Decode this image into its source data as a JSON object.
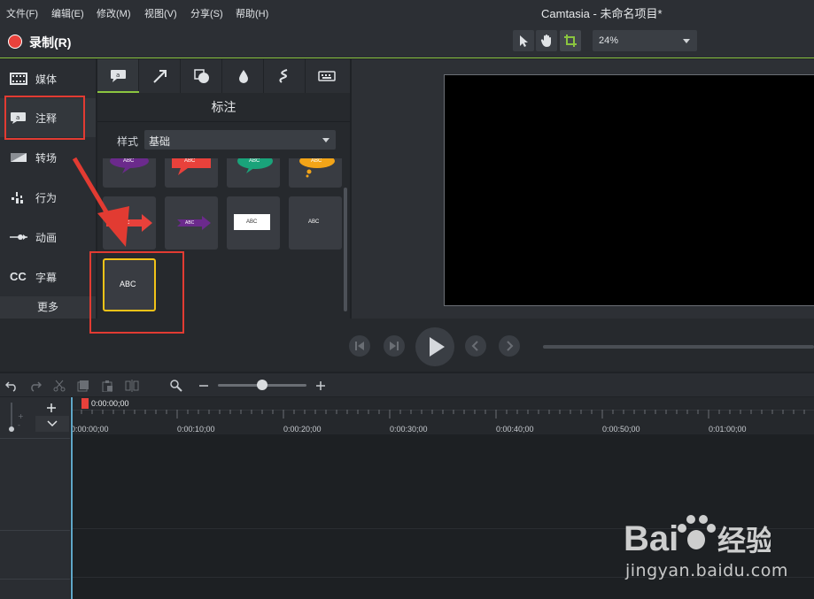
{
  "menu": [
    "文件(F)",
    "编辑(E)",
    "修改(M)",
    "视图(V)",
    "分享(S)",
    "帮助(H)"
  ],
  "window_title": "Camtasia - 未命名项目*",
  "toolbar": {
    "record_label": "录制(R)",
    "zoom": "24%"
  },
  "sidebar": {
    "items": [
      {
        "label": "媒体",
        "icon": "film-strip-icon"
      },
      {
        "label": "注释",
        "icon": "annotation-icon"
      },
      {
        "label": "转场",
        "icon": "transition-icon"
      },
      {
        "label": "行为",
        "icon": "behavior-icon"
      },
      {
        "label": "动画",
        "icon": "animation-icon"
      },
      {
        "label": "字幕",
        "icon": "cc-icon",
        "badge": "CC"
      }
    ],
    "more": "更多"
  },
  "panel": {
    "tabs": [
      "callout-tab-icon",
      "arrow-tab-icon",
      "shape-tab-icon",
      "blur-tab-icon",
      "sketch-tab-icon",
      "keystroke-tab-icon"
    ],
    "heading": "标注",
    "style_label": "样式",
    "style_value": "基础",
    "tile_text": "ABC"
  },
  "timeline": {
    "playhead": "0:00:00;00",
    "ticks": [
      "0:00:00;00",
      "0:00:10;00",
      "0:00:20;00",
      "0:00:30;00",
      "0:00:40;00",
      "0:00:50;00",
      "0:01:00;00"
    ]
  },
  "watermark": {
    "domain": "jingyan.baidu.com"
  },
  "colors": {
    "accent": "#8bc53f",
    "record": "#e8413b",
    "highlight": "#e23b32"
  }
}
